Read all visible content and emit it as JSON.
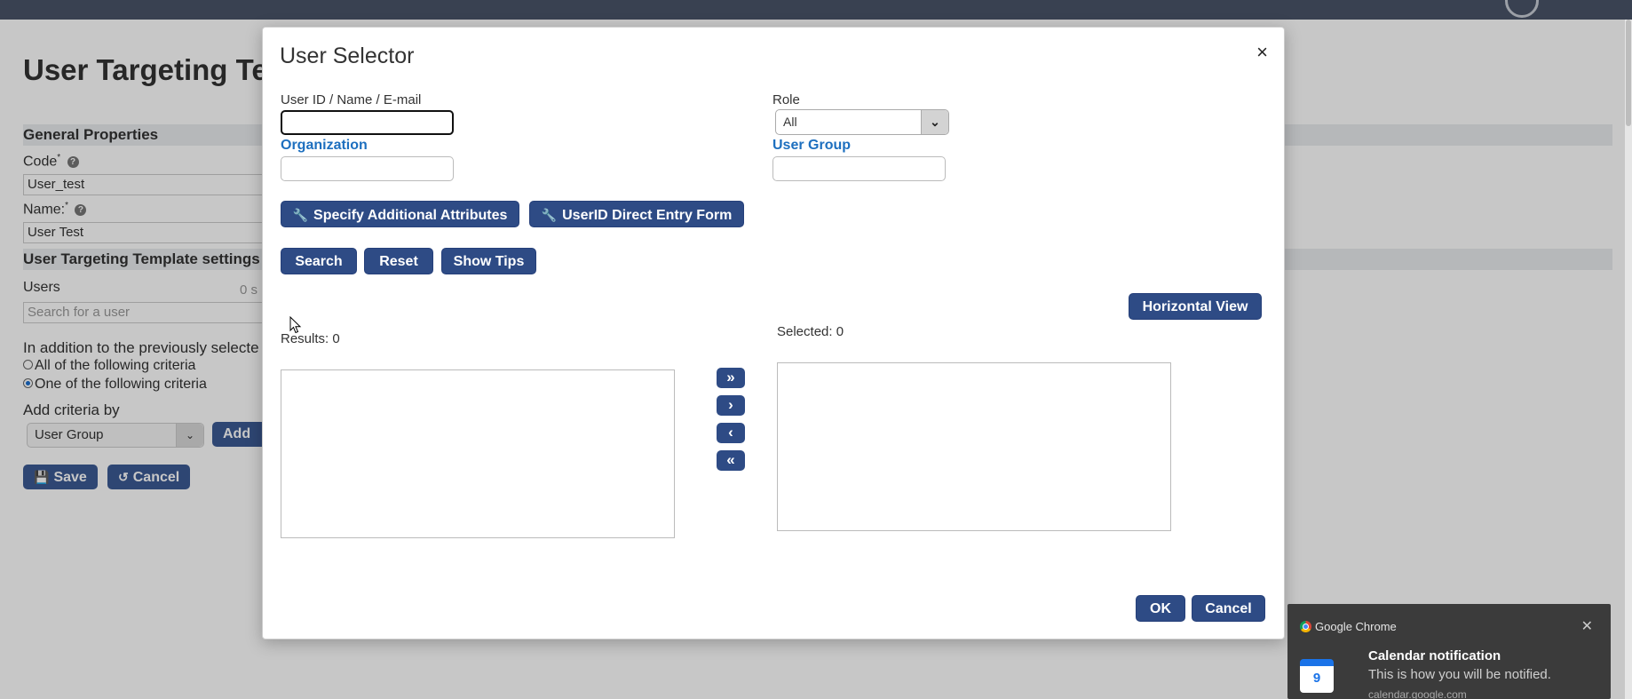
{
  "background": {
    "page_title": "User Targeting Ter",
    "section_general": "General Properties",
    "code_label": "Code",
    "code_required": "*",
    "help_icon": "?",
    "code_value": "User_test",
    "name_label": "Name:",
    "name_required": "*",
    "name_value": "User Test",
    "section_settings": "User Targeting Template settings",
    "users_label": "Users",
    "users_count": "0 s",
    "search_placeholder": "Search for a user",
    "addition_text": "In addition to the previously selecte",
    "radio_all": "All of the following criteria",
    "radio_one": "One of the following criteria",
    "add_criteria_label": "Add criteria by",
    "criteria_select": "User Group",
    "add_button": "Add",
    "save_button": "Save",
    "cancel_button": "Cancel"
  },
  "modal": {
    "title": "User Selector",
    "close": "×",
    "userid_label": "User ID / Name / E-mail",
    "userid_value": "",
    "role_label": "Role",
    "role_value": "All",
    "organization_label": "Organization",
    "organization_value": "",
    "user_group_label": "User Group",
    "user_group_value": "",
    "specify_button": "Specify Additional Attributes",
    "direct_entry_button": "UserID Direct Entry Form",
    "search_button": "Search",
    "reset_button": "Reset",
    "tips_button": "Show Tips",
    "horizontal_button": "Horizontal View",
    "results_text": "Results: 0",
    "selected_text": "Selected: 0",
    "move_all_right": "»",
    "move_right": "›",
    "move_left": "‹",
    "move_all_left": "«",
    "ok_button": "OK",
    "cancel_button": "Cancel"
  },
  "toast": {
    "app_name": "Google Chrome",
    "close": "✕",
    "calendar_day": "9",
    "title": "Calendar notification",
    "message": "This is how you will be notified.",
    "source": "calendar.google.com"
  },
  "icons": {
    "wrench": "wrench-icon",
    "floppy": "save-icon",
    "undo": "undo-icon",
    "chevron": "chevron-down-icon"
  }
}
